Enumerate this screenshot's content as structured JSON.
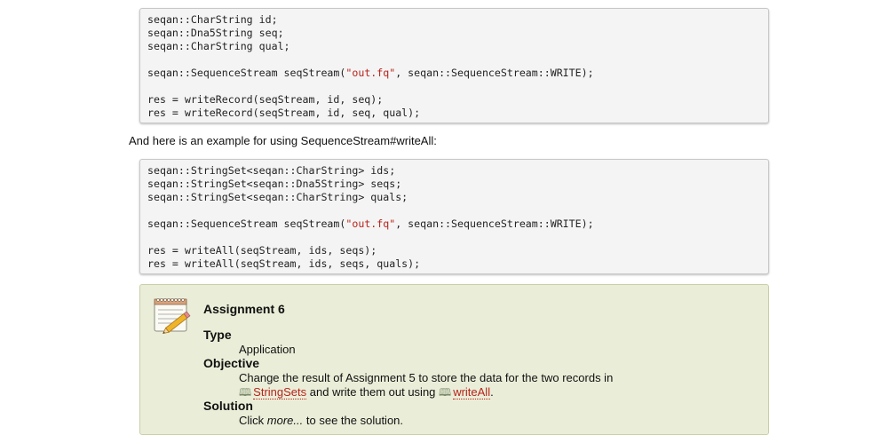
{
  "code_block_1": {
    "lines": [
      "seqan::CharString id;",
      "seqan::Dna5String seq;",
      "seqan::CharString qual;",
      "",
      "seqan::SequenceStream seqStream(\"out.fq\", seqan::SequenceStream::WRITE);",
      "",
      "res = writeRecord(seqStream, id, seq);",
      "res = writeRecord(seqStream, id, seq, qual);"
    ]
  },
  "paragraph": "And here is an example for using SequenceStream#writeAll:",
  "code_block_2": {
    "lines": [
      "seqan::StringSet<seqan::CharString> ids;",
      "seqan::StringSet<seqan::Dna5String> seqs;",
      "seqan::StringSet<seqan::CharString> quals;",
      "",
      "seqan::SequenceStream seqStream(\"out.fq\", seqan::SequenceStream::WRITE);",
      "",
      "res = writeAll(seqStream, ids, seqs);",
      "res = writeAll(seqStream, ids, seqs, quals);"
    ]
  },
  "assignment": {
    "title": "Assignment 6",
    "type_label": "Type",
    "type_value": "Application",
    "objective_label": "Objective",
    "objective_text_1": "Change the result of Assignment 5 to store the data for the two records in",
    "objective_link_1": "StringSets",
    "objective_text_2": "and write them out using",
    "objective_link_2": "writeAll",
    "objective_text_3": ".",
    "solution_label": "Solution",
    "solution_text_1": "Click",
    "solution_more": "more...",
    "solution_text_2": "to see the solution.",
    "icon": "notepad-pencil-icon",
    "link_icon": "book-icon"
  },
  "colors": {
    "string_literal": "#b8231b",
    "link": "#b8231b",
    "assignment_bg": "#eaeed8",
    "code_bg": "#f4f4f4"
  }
}
